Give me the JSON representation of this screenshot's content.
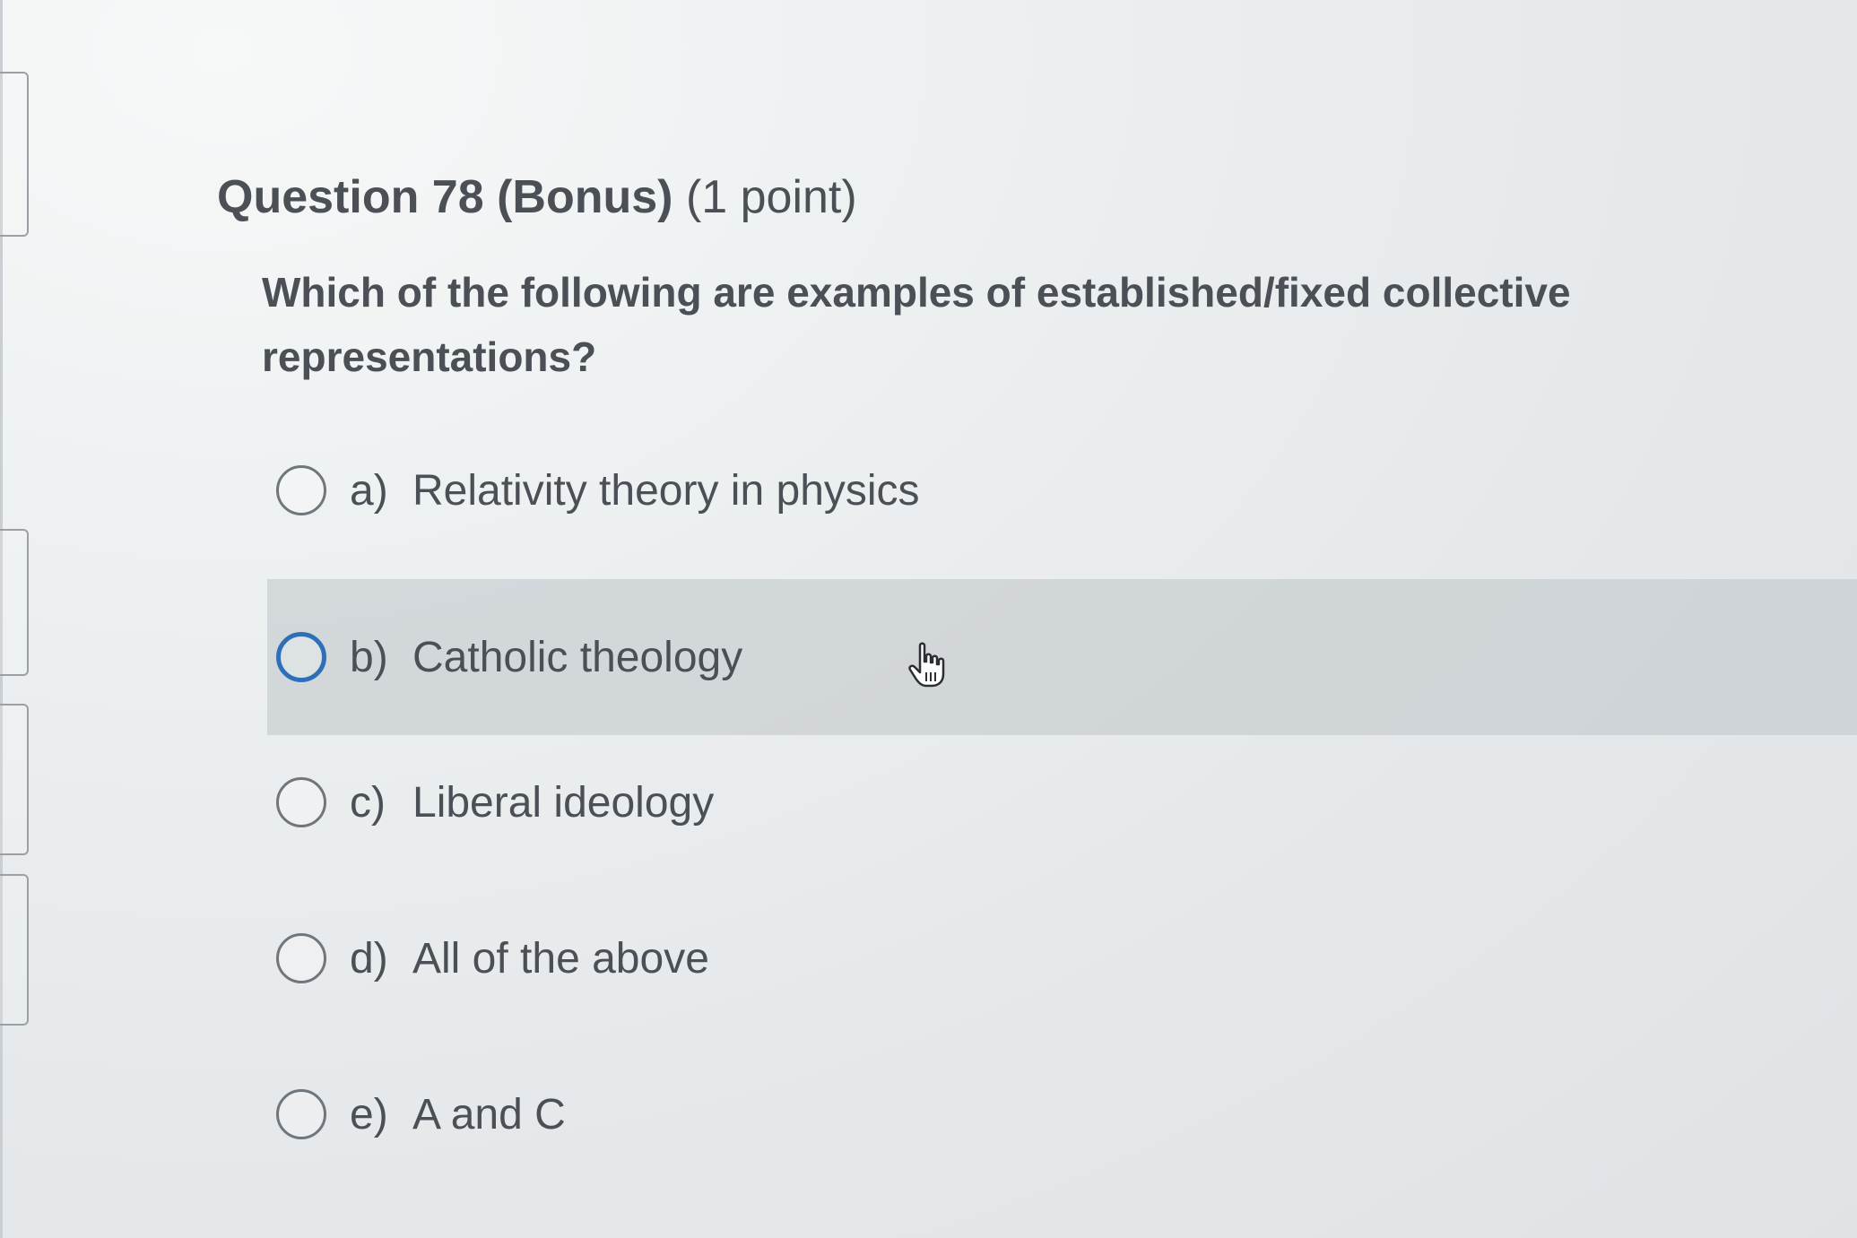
{
  "question": {
    "title_main": "Question 78 (Bonus)",
    "title_points": "(1 point)",
    "text": "Which of the following are examples of established/fixed collective representations?"
  },
  "options": [
    {
      "letter": "a)",
      "label": "Relativity theory in physics"
    },
    {
      "letter": "b)",
      "label": "Catholic theology"
    },
    {
      "letter": "c)",
      "label": "Liberal ideology"
    },
    {
      "letter": "d)",
      "label": "All of the above"
    },
    {
      "letter": "e)",
      "label": "A and C"
    }
  ],
  "state": {
    "hovered_option": "b)",
    "selected_option": null
  },
  "colors": {
    "text": "#4a5056",
    "radio_border": "#6f767c",
    "radio_focus": "#2d6fb8",
    "hover_bg": "#cfd4d8"
  },
  "icons": {
    "cursor": "hand-pointer-icon"
  }
}
